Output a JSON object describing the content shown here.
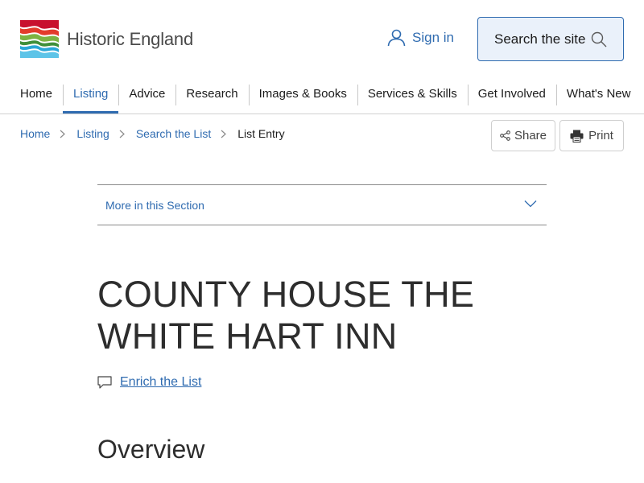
{
  "header": {
    "logo_text": "Historic England",
    "signin_label": "Sign in",
    "search_label": "Search the site"
  },
  "nav": {
    "items": [
      {
        "label": "Home"
      },
      {
        "label": "Listing"
      },
      {
        "label": "Advice"
      },
      {
        "label": "Research"
      },
      {
        "label": "Images & Books"
      },
      {
        "label": "Services & Skills"
      },
      {
        "label": "Get Involved"
      },
      {
        "label": "What's New"
      }
    ],
    "active": "Listing"
  },
  "breadcrumb": {
    "items": [
      "Home",
      "Listing",
      "Search the List"
    ],
    "current": "List Entry"
  },
  "actions": {
    "share_label": "Share",
    "print_label": "Print"
  },
  "section": {
    "toggle_label": "More in this Section"
  },
  "content": {
    "title": "COUNTY HOUSE THE WHITE HART INN",
    "enrich_label": "Enrich the List",
    "overview_heading": "Overview"
  },
  "icons": {
    "user": "user-icon",
    "search": "search-icon",
    "chevron_right": "chevron-right-icon",
    "share": "share-icon",
    "print": "print-icon",
    "chevron_down": "chevron-down-icon",
    "comment": "comment-icon"
  },
  "colors": {
    "link": "#2f6bb0",
    "search_bg": "#eaf1fa",
    "logo_red": "#c8102e",
    "logo_green": "#4a9a3a",
    "logo_blue": "#2aa7d6"
  }
}
